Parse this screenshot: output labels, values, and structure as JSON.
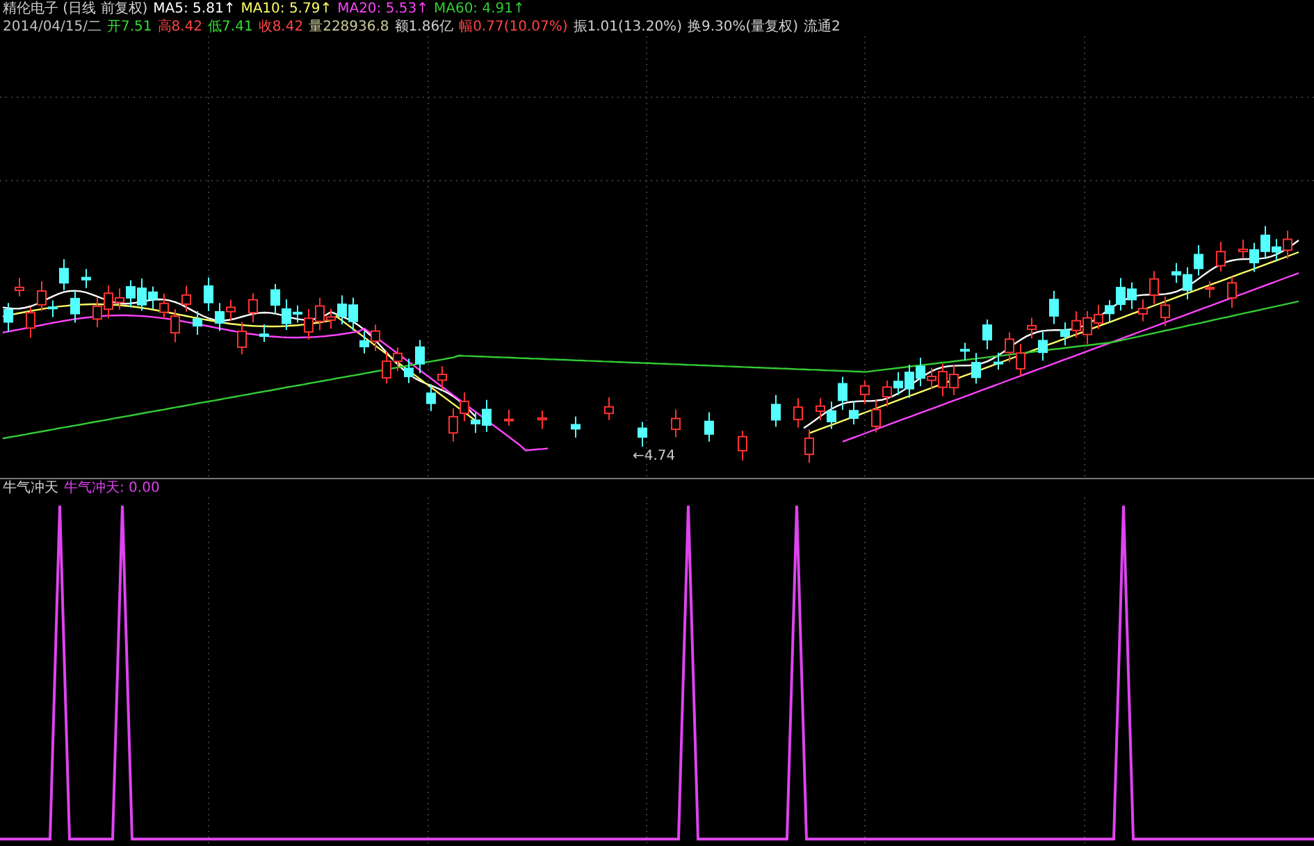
{
  "title_line": {
    "stock": "精伦电子",
    "period": "(日线 前复权)",
    "moving_averages": [
      {
        "label": "MA5: 5.81↑",
        "color": "#ffffff"
      },
      {
        "label": "MA10: 5.79↑",
        "color": "#ffff66"
      },
      {
        "label": "MA20: 5.53↑",
        "color": "#ff44ff"
      },
      {
        "label": "MA60: 4.91↑",
        "color": "#33cc33"
      }
    ]
  },
  "quote_line": [
    {
      "text": "2014/04/15/二",
      "color": "#c0c0c0"
    },
    {
      "text": "开7.51",
      "color": "#33dd33"
    },
    {
      "text": "高8.42",
      "color": "#ff4444"
    },
    {
      "text": "低7.41",
      "color": "#33dd33"
    },
    {
      "text": "收8.42",
      "color": "#ff4444"
    },
    {
      "text": "量228936.8",
      "color": "#cccc99"
    },
    {
      "text": "额1.86亿",
      "color": "#d0d0d0"
    },
    {
      "text": "幅0.77(10.07%)",
      "color": "#ff4444"
    },
    {
      "text": "振1.01(13.20%)",
      "color": "#d0d0d0"
    },
    {
      "text": "换9.30%(量复权)",
      "color": "#d0d0d0"
    },
    {
      "text": "流通2",
      "color": "#d0d0d0"
    }
  ],
  "price_chart": {
    "low_marker": "←4.74"
  },
  "indicator": {
    "name": "牛气冲天",
    "series": [
      {
        "label": "牛气冲天: 0.00",
        "color": "#dd44ee"
      }
    ]
  }
}
